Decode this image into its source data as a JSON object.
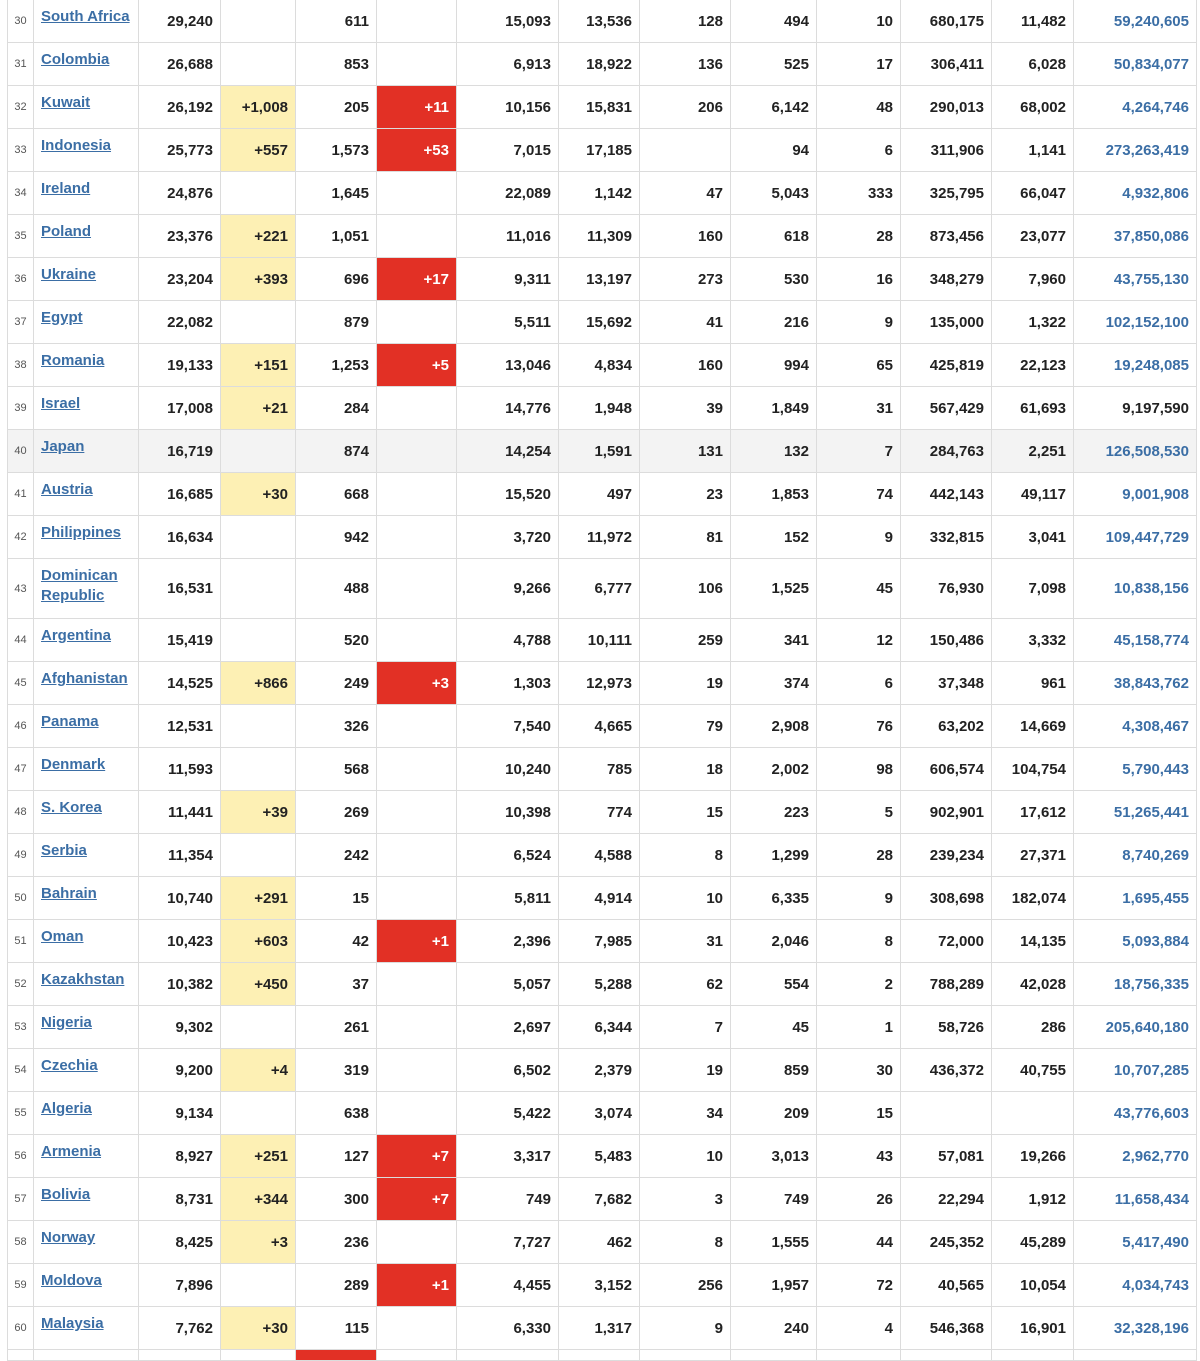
{
  "colors": {
    "link": "#3b6ea5",
    "new_cases_bg": "#fdf0b4",
    "new_deaths_bg": "#e23025",
    "highlight_row": "#f3f3f3"
  },
  "rows": [
    {
      "n": "30",
      "country": "South Africa",
      "total_cases": "29,240",
      "new_cases": "",
      "total_deaths": "611",
      "new_deaths": "",
      "recovered": "15,093",
      "active": "13,536",
      "serious": "128",
      "cases_per_1m": "494",
      "deaths_per_1m": "10",
      "total_tests": "680,175",
      "tests_per_1m": "11,482",
      "population": "59,240,605",
      "pop_link": true
    },
    {
      "n": "31",
      "country": "Colombia",
      "total_cases": "26,688",
      "new_cases": "",
      "total_deaths": "853",
      "new_deaths": "",
      "recovered": "6,913",
      "active": "18,922",
      "serious": "136",
      "cases_per_1m": "525",
      "deaths_per_1m": "17",
      "total_tests": "306,411",
      "tests_per_1m": "6,028",
      "population": "50,834,077",
      "pop_link": true
    },
    {
      "n": "32",
      "country": "Kuwait",
      "total_cases": "26,192",
      "new_cases": "+1,008",
      "total_deaths": "205",
      "new_deaths": "+11",
      "recovered": "10,156",
      "active": "15,831",
      "serious": "206",
      "cases_per_1m": "6,142",
      "deaths_per_1m": "48",
      "total_tests": "290,013",
      "tests_per_1m": "68,002",
      "population": "4,264,746",
      "pop_link": true
    },
    {
      "n": "33",
      "country": "Indonesia",
      "total_cases": "25,773",
      "new_cases": "+557",
      "total_deaths": "1,573",
      "new_deaths": "+53",
      "recovered": "7,015",
      "active": "17,185",
      "serious": "",
      "cases_per_1m": "94",
      "deaths_per_1m": "6",
      "total_tests": "311,906",
      "tests_per_1m": "1,141",
      "population": "273,263,419",
      "pop_link": true
    },
    {
      "n": "34",
      "country": "Ireland",
      "total_cases": "24,876",
      "new_cases": "",
      "total_deaths": "1,645",
      "new_deaths": "",
      "recovered": "22,089",
      "active": "1,142",
      "serious": "47",
      "cases_per_1m": "5,043",
      "deaths_per_1m": "333",
      "total_tests": "325,795",
      "tests_per_1m": "66,047",
      "population": "4,932,806",
      "pop_link": true
    },
    {
      "n": "35",
      "country": "Poland",
      "total_cases": "23,376",
      "new_cases": "+221",
      "total_deaths": "1,051",
      "new_deaths": "",
      "recovered": "11,016",
      "active": "11,309",
      "serious": "160",
      "cases_per_1m": "618",
      "deaths_per_1m": "28",
      "total_tests": "873,456",
      "tests_per_1m": "23,077",
      "population": "37,850,086",
      "pop_link": true
    },
    {
      "n": "36",
      "country": "Ukraine",
      "total_cases": "23,204",
      "new_cases": "+393",
      "total_deaths": "696",
      "new_deaths": "+17",
      "recovered": "9,311",
      "active": "13,197",
      "serious": "273",
      "cases_per_1m": "530",
      "deaths_per_1m": "16",
      "total_tests": "348,279",
      "tests_per_1m": "7,960",
      "population": "43,755,130",
      "pop_link": true
    },
    {
      "n": "37",
      "country": "Egypt",
      "total_cases": "22,082",
      "new_cases": "",
      "total_deaths": "879",
      "new_deaths": "",
      "recovered": "5,511",
      "active": "15,692",
      "serious": "41",
      "cases_per_1m": "216",
      "deaths_per_1m": "9",
      "total_tests": "135,000",
      "tests_per_1m": "1,322",
      "population": "102,152,100",
      "pop_link": true
    },
    {
      "n": "38",
      "country": "Romania",
      "total_cases": "19,133",
      "new_cases": "+151",
      "total_deaths": "1,253",
      "new_deaths": "+5",
      "recovered": "13,046",
      "active": "4,834",
      "serious": "160",
      "cases_per_1m": "994",
      "deaths_per_1m": "65",
      "total_tests": "425,819",
      "tests_per_1m": "22,123",
      "population": "19,248,085",
      "pop_link": true
    },
    {
      "n": "39",
      "country": "Israel",
      "total_cases": "17,008",
      "new_cases": "+21",
      "total_deaths": "284",
      "new_deaths": "",
      "recovered": "14,776",
      "active": "1,948",
      "serious": "39",
      "cases_per_1m": "1,849",
      "deaths_per_1m": "31",
      "total_tests": "567,429",
      "tests_per_1m": "61,693",
      "population": "9,197,590",
      "pop_link": false
    },
    {
      "n": "40",
      "country": "Japan",
      "total_cases": "16,719",
      "new_cases": "",
      "total_deaths": "874",
      "new_deaths": "",
      "recovered": "14,254",
      "active": "1,591",
      "serious": "131",
      "cases_per_1m": "132",
      "deaths_per_1m": "7",
      "total_tests": "284,763",
      "tests_per_1m": "2,251",
      "population": "126,508,530",
      "pop_link": true,
      "highlight": true
    },
    {
      "n": "41",
      "country": "Austria",
      "total_cases": "16,685",
      "new_cases": "+30",
      "total_deaths": "668",
      "new_deaths": "",
      "recovered": "15,520",
      "active": "497",
      "serious": "23",
      "cases_per_1m": "1,853",
      "deaths_per_1m": "74",
      "total_tests": "442,143",
      "tests_per_1m": "49,117",
      "population": "9,001,908",
      "pop_link": true
    },
    {
      "n": "42",
      "country": "Philippines",
      "total_cases": "16,634",
      "new_cases": "",
      "total_deaths": "942",
      "new_deaths": "",
      "recovered": "3,720",
      "active": "11,972",
      "serious": "81",
      "cases_per_1m": "152",
      "deaths_per_1m": "9",
      "total_tests": "332,815",
      "tests_per_1m": "3,041",
      "population": "109,447,729",
      "pop_link": true
    },
    {
      "n": "43",
      "country": "Dominican Republic",
      "total_cases": "16,531",
      "new_cases": "",
      "total_deaths": "488",
      "new_deaths": "",
      "recovered": "9,266",
      "active": "6,777",
      "serious": "106",
      "cases_per_1m": "1,525",
      "deaths_per_1m": "45",
      "total_tests": "76,930",
      "tests_per_1m": "7,098",
      "population": "10,838,156",
      "pop_link": true,
      "tall": true
    },
    {
      "n": "44",
      "country": "Argentina",
      "total_cases": "15,419",
      "new_cases": "",
      "total_deaths": "520",
      "new_deaths": "",
      "recovered": "4,788",
      "active": "10,111",
      "serious": "259",
      "cases_per_1m": "341",
      "deaths_per_1m": "12",
      "total_tests": "150,486",
      "tests_per_1m": "3,332",
      "population": "45,158,774",
      "pop_link": true
    },
    {
      "n": "45",
      "country": "Afghanistan",
      "total_cases": "14,525",
      "new_cases": "+866",
      "total_deaths": "249",
      "new_deaths": "+3",
      "recovered": "1,303",
      "active": "12,973",
      "serious": "19",
      "cases_per_1m": "374",
      "deaths_per_1m": "6",
      "total_tests": "37,348",
      "tests_per_1m": "961",
      "population": "38,843,762",
      "pop_link": true
    },
    {
      "n": "46",
      "country": "Panama",
      "total_cases": "12,531",
      "new_cases": "",
      "total_deaths": "326",
      "new_deaths": "",
      "recovered": "7,540",
      "active": "4,665",
      "serious": "79",
      "cases_per_1m": "2,908",
      "deaths_per_1m": "76",
      "total_tests": "63,202",
      "tests_per_1m": "14,669",
      "population": "4,308,467",
      "pop_link": true
    },
    {
      "n": "47",
      "country": "Denmark",
      "total_cases": "11,593",
      "new_cases": "",
      "total_deaths": "568",
      "new_deaths": "",
      "recovered": "10,240",
      "active": "785",
      "serious": "18",
      "cases_per_1m": "2,002",
      "deaths_per_1m": "98",
      "total_tests": "606,574",
      "tests_per_1m": "104,754",
      "population": "5,790,443",
      "pop_link": true
    },
    {
      "n": "48",
      "country": "S. Korea",
      "total_cases": "11,441",
      "new_cases": "+39",
      "total_deaths": "269",
      "new_deaths": "",
      "recovered": "10,398",
      "active": "774",
      "serious": "15",
      "cases_per_1m": "223",
      "deaths_per_1m": "5",
      "total_tests": "902,901",
      "tests_per_1m": "17,612",
      "population": "51,265,441",
      "pop_link": true
    },
    {
      "n": "49",
      "country": "Serbia",
      "total_cases": "11,354",
      "new_cases": "",
      "total_deaths": "242",
      "new_deaths": "",
      "recovered": "6,524",
      "active": "4,588",
      "serious": "8",
      "cases_per_1m": "1,299",
      "deaths_per_1m": "28",
      "total_tests": "239,234",
      "tests_per_1m": "27,371",
      "population": "8,740,269",
      "pop_link": true
    },
    {
      "n": "50",
      "country": "Bahrain",
      "total_cases": "10,740",
      "new_cases": "+291",
      "total_deaths": "15",
      "new_deaths": "",
      "recovered": "5,811",
      "active": "4,914",
      "serious": "10",
      "cases_per_1m": "6,335",
      "deaths_per_1m": "9",
      "total_tests": "308,698",
      "tests_per_1m": "182,074",
      "population": "1,695,455",
      "pop_link": true
    },
    {
      "n": "51",
      "country": "Oman",
      "total_cases": "10,423",
      "new_cases": "+603",
      "total_deaths": "42",
      "new_deaths": "+1",
      "recovered": "2,396",
      "active": "7,985",
      "serious": "31",
      "cases_per_1m": "2,046",
      "deaths_per_1m": "8",
      "total_tests": "72,000",
      "tests_per_1m": "14,135",
      "population": "5,093,884",
      "pop_link": true
    },
    {
      "n": "52",
      "country": "Kazakhstan",
      "total_cases": "10,382",
      "new_cases": "+450",
      "total_deaths": "37",
      "new_deaths": "",
      "recovered": "5,057",
      "active": "5,288",
      "serious": "62",
      "cases_per_1m": "554",
      "deaths_per_1m": "2",
      "total_tests": "788,289",
      "tests_per_1m": "42,028",
      "population": "18,756,335",
      "pop_link": true
    },
    {
      "n": "53",
      "country": "Nigeria",
      "total_cases": "9,302",
      "new_cases": "",
      "total_deaths": "261",
      "new_deaths": "",
      "recovered": "2,697",
      "active": "6,344",
      "serious": "7",
      "cases_per_1m": "45",
      "deaths_per_1m": "1",
      "total_tests": "58,726",
      "tests_per_1m": "286",
      "population": "205,640,180",
      "pop_link": true
    },
    {
      "n": "54",
      "country": "Czechia",
      "total_cases": "9,200",
      "new_cases": "+4",
      "total_deaths": "319",
      "new_deaths": "",
      "recovered": "6,502",
      "active": "2,379",
      "serious": "19",
      "cases_per_1m": "859",
      "deaths_per_1m": "30",
      "total_tests": "436,372",
      "tests_per_1m": "40,755",
      "population": "10,707,285",
      "pop_link": true
    },
    {
      "n": "55",
      "country": "Algeria",
      "total_cases": "9,134",
      "new_cases": "",
      "total_deaths": "638",
      "new_deaths": "",
      "recovered": "5,422",
      "active": "3,074",
      "serious": "34",
      "cases_per_1m": "209",
      "deaths_per_1m": "15",
      "total_tests": "",
      "tests_per_1m": "",
      "population": "43,776,603",
      "pop_link": true
    },
    {
      "n": "56",
      "country": "Armenia",
      "total_cases": "8,927",
      "new_cases": "+251",
      "total_deaths": "127",
      "new_deaths": "+7",
      "recovered": "3,317",
      "active": "5,483",
      "serious": "10",
      "cases_per_1m": "3,013",
      "deaths_per_1m": "43",
      "total_tests": "57,081",
      "tests_per_1m": "19,266",
      "population": "2,962,770",
      "pop_link": true
    },
    {
      "n": "57",
      "country": "Bolivia",
      "total_cases": "8,731",
      "new_cases": "+344",
      "total_deaths": "300",
      "new_deaths": "+7",
      "recovered": "749",
      "active": "7,682",
      "serious": "3",
      "cases_per_1m": "749",
      "deaths_per_1m": "26",
      "total_tests": "22,294",
      "tests_per_1m": "1,912",
      "population": "11,658,434",
      "pop_link": true
    },
    {
      "n": "58",
      "country": "Norway",
      "total_cases": "8,425",
      "new_cases": "+3",
      "total_deaths": "236",
      "new_deaths": "",
      "recovered": "7,727",
      "active": "462",
      "serious": "8",
      "cases_per_1m": "1,555",
      "deaths_per_1m": "44",
      "total_tests": "245,352",
      "tests_per_1m": "45,289",
      "population": "5,417,490",
      "pop_link": true
    },
    {
      "n": "59",
      "country": "Moldova",
      "total_cases": "7,896",
      "new_cases": "",
      "total_deaths": "289",
      "new_deaths": "+1",
      "recovered": "4,455",
      "active": "3,152",
      "serious": "256",
      "cases_per_1m": "1,957",
      "deaths_per_1m": "72",
      "total_tests": "40,565",
      "tests_per_1m": "10,054",
      "population": "4,034,743",
      "pop_link": true
    },
    {
      "n": "60",
      "country": "Malaysia",
      "total_cases": "7,762",
      "new_cases": "+30",
      "total_deaths": "115",
      "new_deaths": "",
      "recovered": "6,330",
      "active": "1,317",
      "serious": "9",
      "cases_per_1m": "240",
      "deaths_per_1m": "4",
      "total_tests": "546,368",
      "tests_per_1m": "16,901",
      "population": "32,328,196",
      "pop_link": true
    }
  ]
}
